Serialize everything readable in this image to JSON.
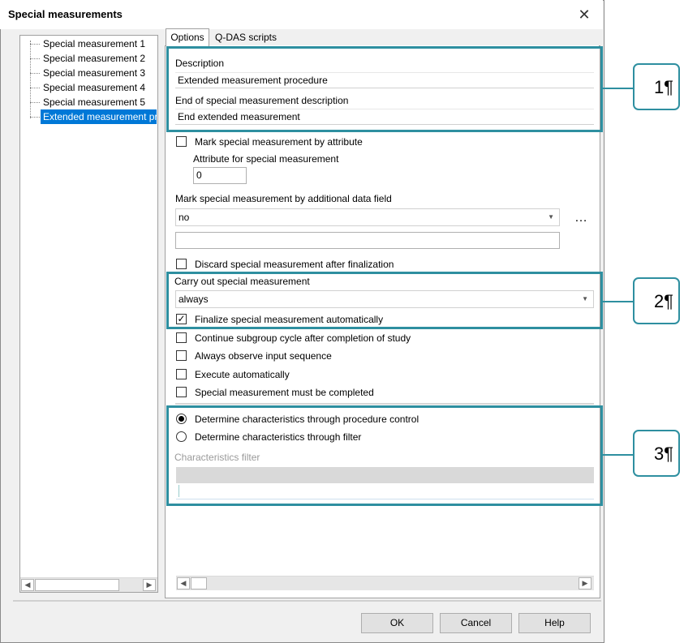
{
  "window": {
    "title": "Special measurements"
  },
  "tree": {
    "items": [
      "Special measurement 1",
      "Special measurement 2",
      "Special measurement 3",
      "Special measurement 4",
      "Special measurement 5",
      "Extended measurement procedure"
    ],
    "selected": "Extended measurement procedure"
  },
  "tabs": [
    "Options",
    "Q-DAS scripts"
  ],
  "options": {
    "description_label": "Description",
    "description_value": "Extended measurement procedure",
    "end_description_label": "End of special measurement description",
    "end_description_value": "End extended measurement",
    "mark_by_attribute_label": "Mark special measurement by attribute",
    "attribute_label": "Attribute for special measurement",
    "attribute_value": "0",
    "mark_by_field_label": "Mark special measurement by additional data field",
    "mark_by_field_value": "no",
    "more_button": "…",
    "discard_label": "Discard special measurement after finalization",
    "carry_out_label": "Carry out special measurement",
    "carry_out_value": "always",
    "finalize_label": "Finalize special measurement automatically",
    "continue_label": "Continue subgroup cycle after completion of study",
    "observe_label": "Always observe input sequence",
    "execute_label": "Execute automatically",
    "must_complete_label": "Special measurement must be completed",
    "radio_procedure_label": "Determine characteristics through procedure control",
    "radio_filter_label": "Determine characteristics through filter",
    "filter_label": "Characteristics filter"
  },
  "callouts": [
    "1¶",
    "2¶",
    "3¶"
  ],
  "buttons": {
    "ok": "OK",
    "cancel": "Cancel",
    "help": "Help"
  },
  "colors": {
    "accent": "#2e8fa0",
    "selection": "#0078d7"
  }
}
